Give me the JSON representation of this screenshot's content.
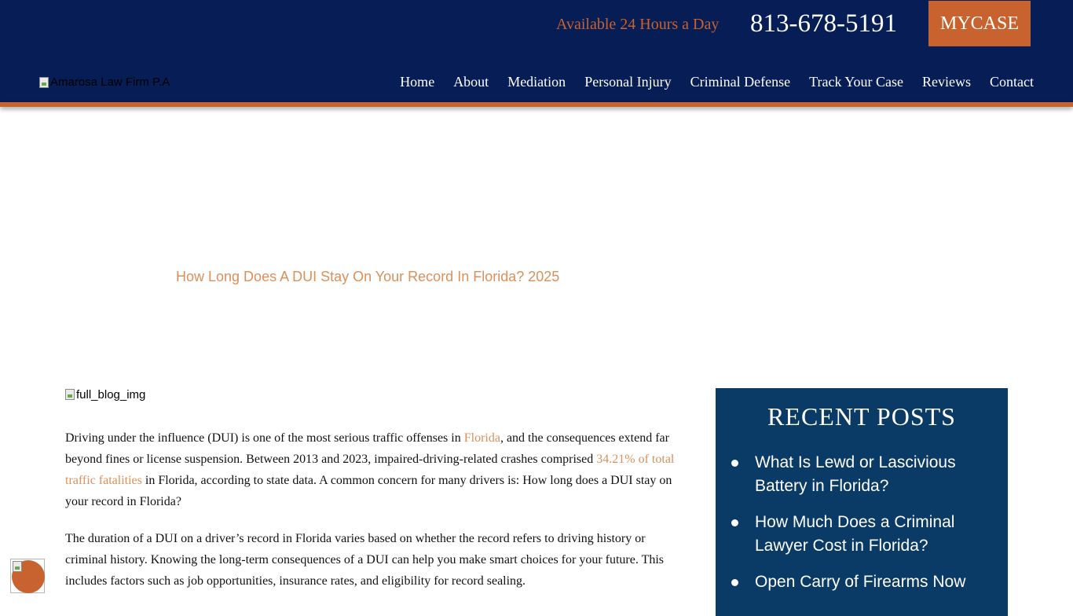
{
  "header": {
    "availability": "Available 24 Hours a Day",
    "phone": "813-678-5191",
    "mycase_label": "MYCASE",
    "logo_alt": "Amarosa Law Firm P.A",
    "nav": [
      "Home",
      "About",
      "Mediation",
      "Personal Injury",
      "Criminal Defense",
      "Track Your Case",
      "Reviews",
      "Contact"
    ]
  },
  "hero": {
    "title": "How Long Does A DUI Stay On Your Record In Florida? 2025"
  },
  "article": {
    "image_alt": "full_blog_img",
    "p1_before": "Driving under the influence (DUI) is one of the most serious traffic offenses in ",
    "p1_link1": "Florida",
    "p1_mid": ", and the consequences extend far beyond fines or license suspension. Between 2013 and 2023, impaired-driving-related crashes comprised ",
    "p1_link2": "34.21% of total traffic fatalities",
    "p1_after": " in Florida, according to state data. A common concern for many drivers is: How long does a DUI stay on your record in Florida?",
    "p2": "The duration of a DUI on a driver’s record in Florida varies based on whether the record refers to driving history or criminal history. Knowing the long-term consequences of a DUI can help you make smart choices for your future. This includes factors such as job opportunities, insurance rates, and eligibility for record sealing."
  },
  "sidebar": {
    "title": "RECENT POSTS",
    "posts": [
      "What Is Lewd or Lascivious Battery in Florida?",
      "How Much Does a Criminal Lawyer Cost in Florida?",
      "Open Carry of Firearms Now"
    ]
  },
  "colors": {
    "navy": "#061d55",
    "orange": "#c8622e",
    "link": "#d9905a",
    "sidebar_blue": "#0a3a66"
  }
}
